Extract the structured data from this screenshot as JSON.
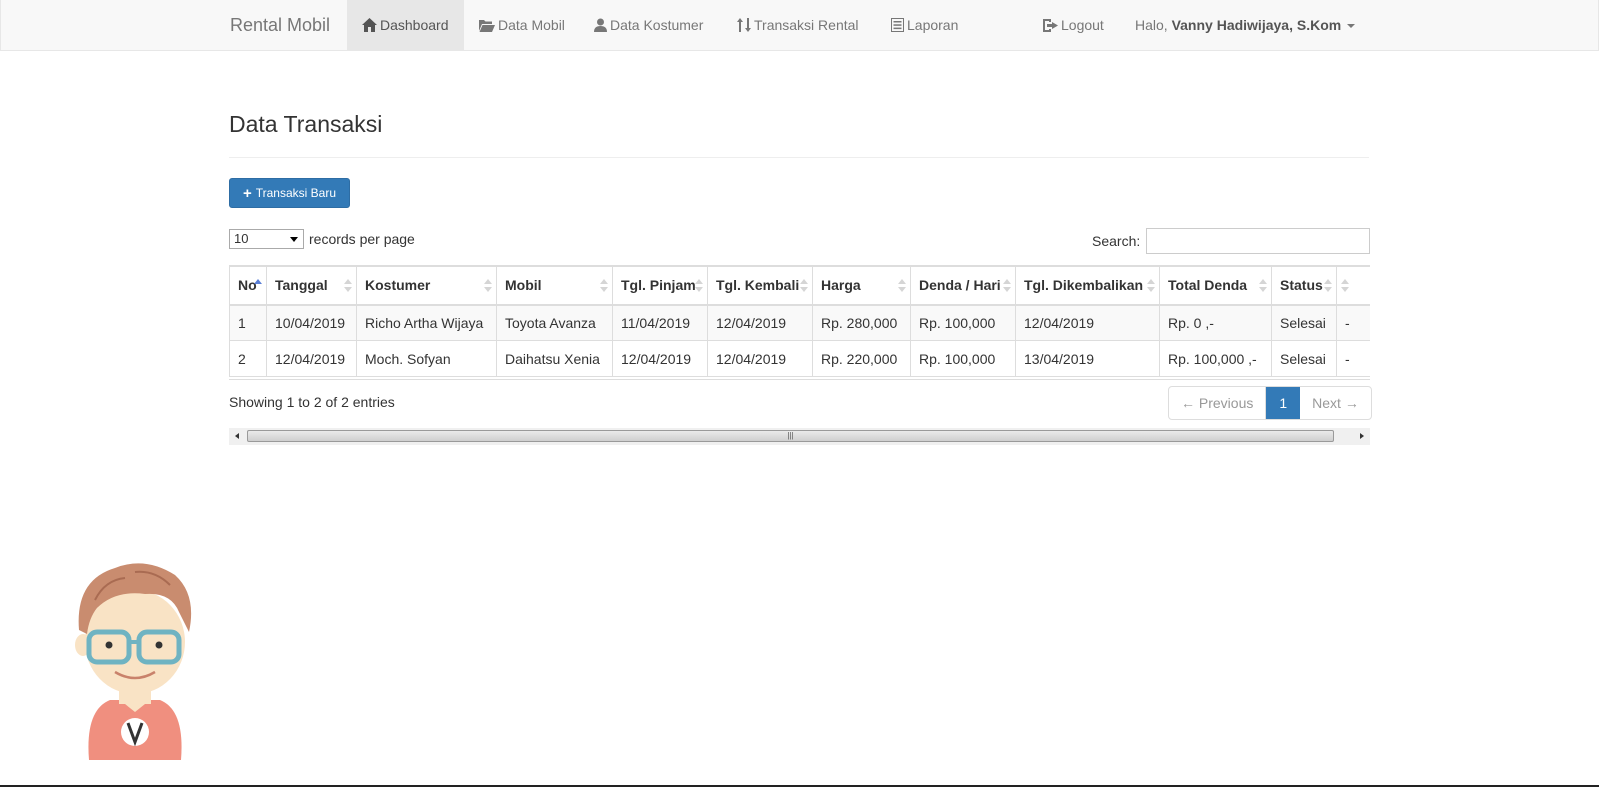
{
  "navbar": {
    "brand": "Rental Mobil",
    "items": [
      {
        "label": "Dashboard",
        "icon": "home-icon",
        "active": true
      },
      {
        "label": "Data Mobil",
        "icon": "folder-open-icon"
      },
      {
        "label": "Data Kostumer",
        "icon": "user-icon"
      },
      {
        "label": "Transaksi Rental",
        "icon": "sort-arrows-icon"
      },
      {
        "label": "Laporan",
        "icon": "list-alt-icon"
      }
    ],
    "logout": "Logout",
    "greeting": "Halo,",
    "user_name": "Vanny Hadiwijaya, S.Kom"
  },
  "page": {
    "title": "Data Transaksi",
    "new_button": "Transaksi Baru"
  },
  "table_controls": {
    "page_length": "10",
    "length_label": "records per page",
    "search_label": "Search:",
    "search_value": ""
  },
  "table": {
    "columns": [
      "No",
      "Tanggal",
      "Kostumer",
      "Mobil",
      "Tgl. Pinjam",
      "Tgl. Kembali",
      "Harga",
      "Denda / Hari",
      "Tgl. Dikembalikan",
      "Total Denda",
      "Status",
      ""
    ],
    "rows": [
      [
        "1",
        "10/04/2019",
        "Richo Artha Wijaya",
        "Toyota Avanza",
        "11/04/2019",
        "12/04/2019",
        "Rp. 280,000",
        "Rp. 100,000",
        "12/04/2019",
        "Rp. 0 ,-",
        "Selesai",
        "-"
      ],
      [
        "2",
        "12/04/2019",
        "Moch. Sofyan",
        "Daihatsu Xenia",
        "12/04/2019",
        "12/04/2019",
        "Rp. 220,000",
        "Rp. 100,000",
        "13/04/2019",
        "Rp. 100,000 ,-",
        "Selesai",
        "-"
      ]
    ]
  },
  "pagination": {
    "info": "Showing 1 to 2 of 2 entries",
    "previous": "← Previous",
    "current": "1",
    "next": "Next →"
  },
  "colors": {
    "primary": "#337ab7",
    "navbar_bg": "#f8f8f8"
  }
}
